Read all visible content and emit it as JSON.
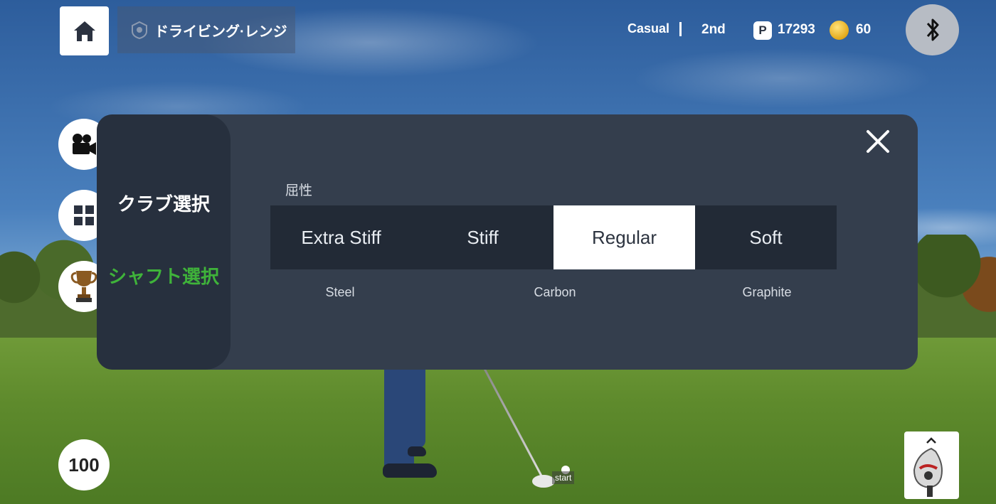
{
  "topbar": {
    "mode_label": "ドライビング·レンジ",
    "difficulty": "Casual",
    "rank": "2nd",
    "points_badge": "P",
    "points": "17293",
    "coins": "60"
  },
  "sidebar_counter": "100",
  "modal": {
    "menu": {
      "club_select": "クラブ選択",
      "shaft_select": "シャフト選択"
    },
    "section_label": "屈性",
    "flex_options": [
      "Extra Stiff",
      "Stiff",
      "Regular",
      "Soft"
    ],
    "selected_flex": "Regular",
    "materials": [
      "Steel",
      "Carbon",
      "Graphite"
    ]
  },
  "scene": {
    "start_label": "start"
  },
  "colors": {
    "accent_green": "#3fb33a",
    "modal_bg": "#343e4d",
    "modal_sidebar": "#27303e",
    "option_row": "#222a36"
  }
}
